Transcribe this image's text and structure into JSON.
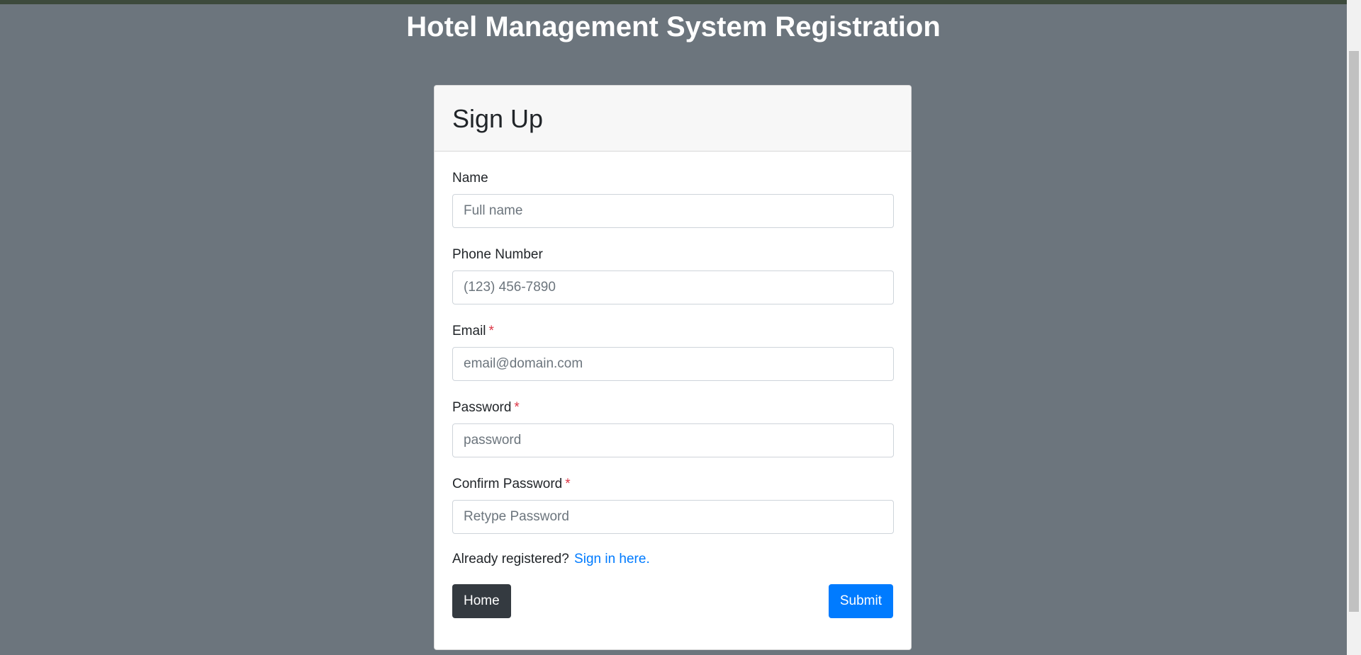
{
  "page": {
    "title": "Hotel Management System Registration"
  },
  "card": {
    "header": "Sign Up"
  },
  "form": {
    "name": {
      "label": "Name",
      "placeholder": "Full name",
      "required": false
    },
    "phone": {
      "label": "Phone Number",
      "placeholder": "(123) 456-7890",
      "required": false
    },
    "email": {
      "label": "Email",
      "placeholder": "email@domain.com",
      "required": true
    },
    "password": {
      "label": "Password",
      "placeholder": "password",
      "required": true
    },
    "confirm_password": {
      "label": "Confirm Password",
      "placeholder": "Retype Password",
      "required": true
    },
    "required_marker": "*"
  },
  "signin": {
    "prompt": "Already registered?",
    "link_text": "Sign in here."
  },
  "buttons": {
    "home": "Home",
    "submit": "Submit"
  },
  "colors": {
    "background": "#6c757d",
    "primary": "#007bff",
    "dark": "#343a40",
    "required": "#dc3545"
  }
}
